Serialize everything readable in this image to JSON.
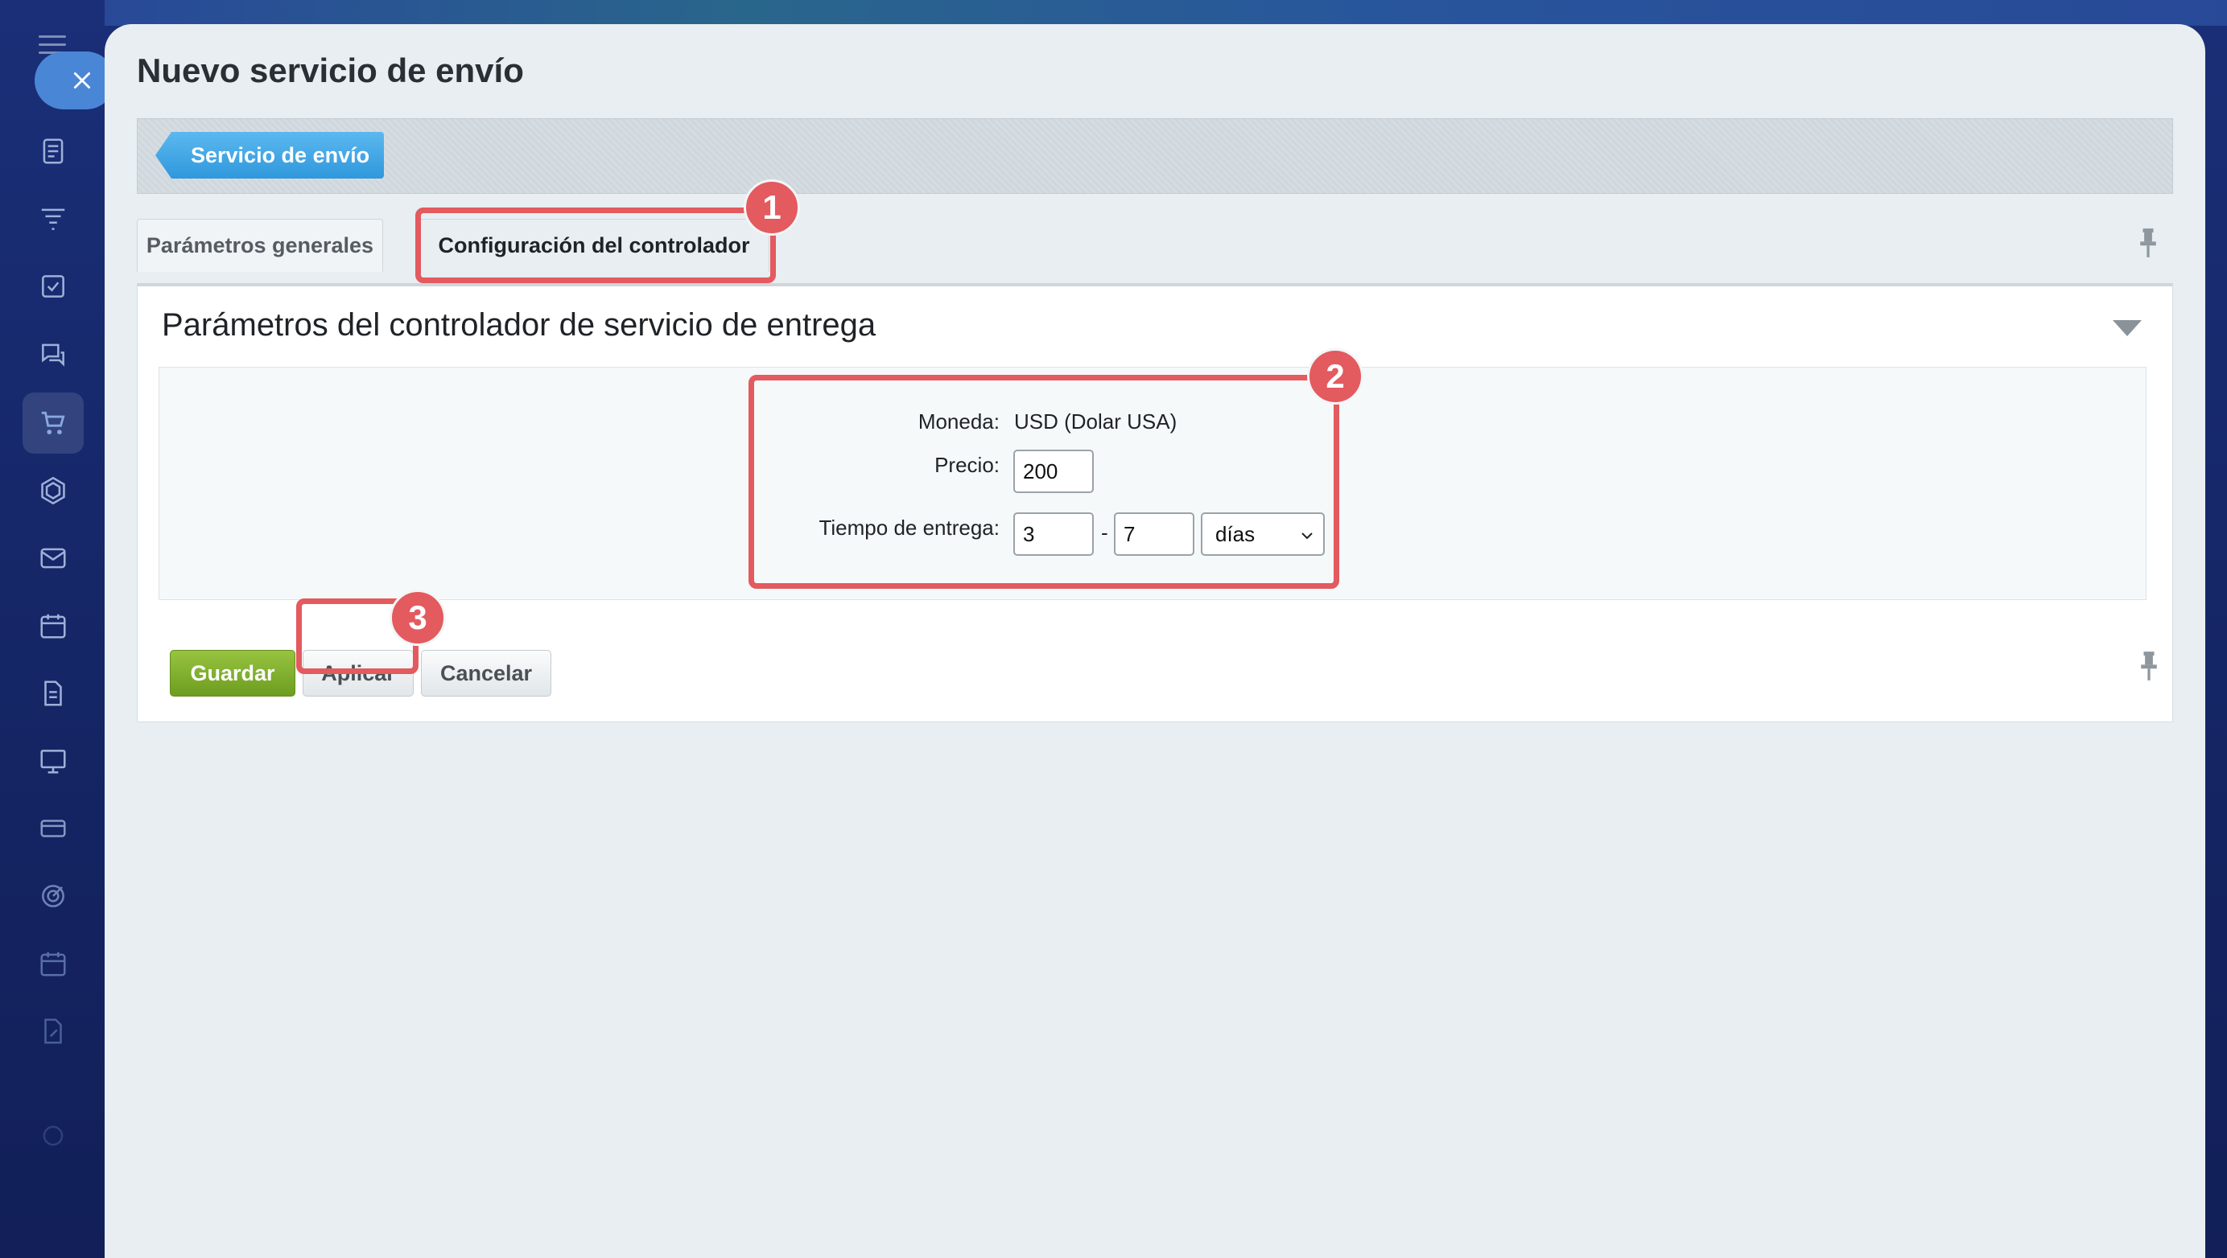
{
  "panel": {
    "title": "Nuevo servicio de envío",
    "breadcrumb": "Servicio de envío"
  },
  "tabs": [
    {
      "label": "Parámetros generales",
      "active": false
    },
    {
      "label": "Configuración del controlador",
      "active": true
    }
  ],
  "section": {
    "title": "Parámetros del controlador de servicio de entrega"
  },
  "form": {
    "currency_label": "Moneda:",
    "currency_value": "USD (Dolar USA)",
    "price_label": "Precio:",
    "price_value": "200",
    "delivery_label": "Tiempo de entrega:",
    "delivery_from": "3",
    "delivery_separator": "-",
    "delivery_to": "7",
    "delivery_unit": "días"
  },
  "buttons": {
    "save": "Guardar",
    "apply": "Aplicar",
    "cancel": "Cancelar"
  },
  "annotations": [
    "1",
    "2",
    "3"
  ],
  "colors": {
    "annotation": "#e35a5f",
    "save_button": "#7aab28",
    "breadcrumb": "#3ea3e2",
    "close_button": "#4a86d6"
  }
}
